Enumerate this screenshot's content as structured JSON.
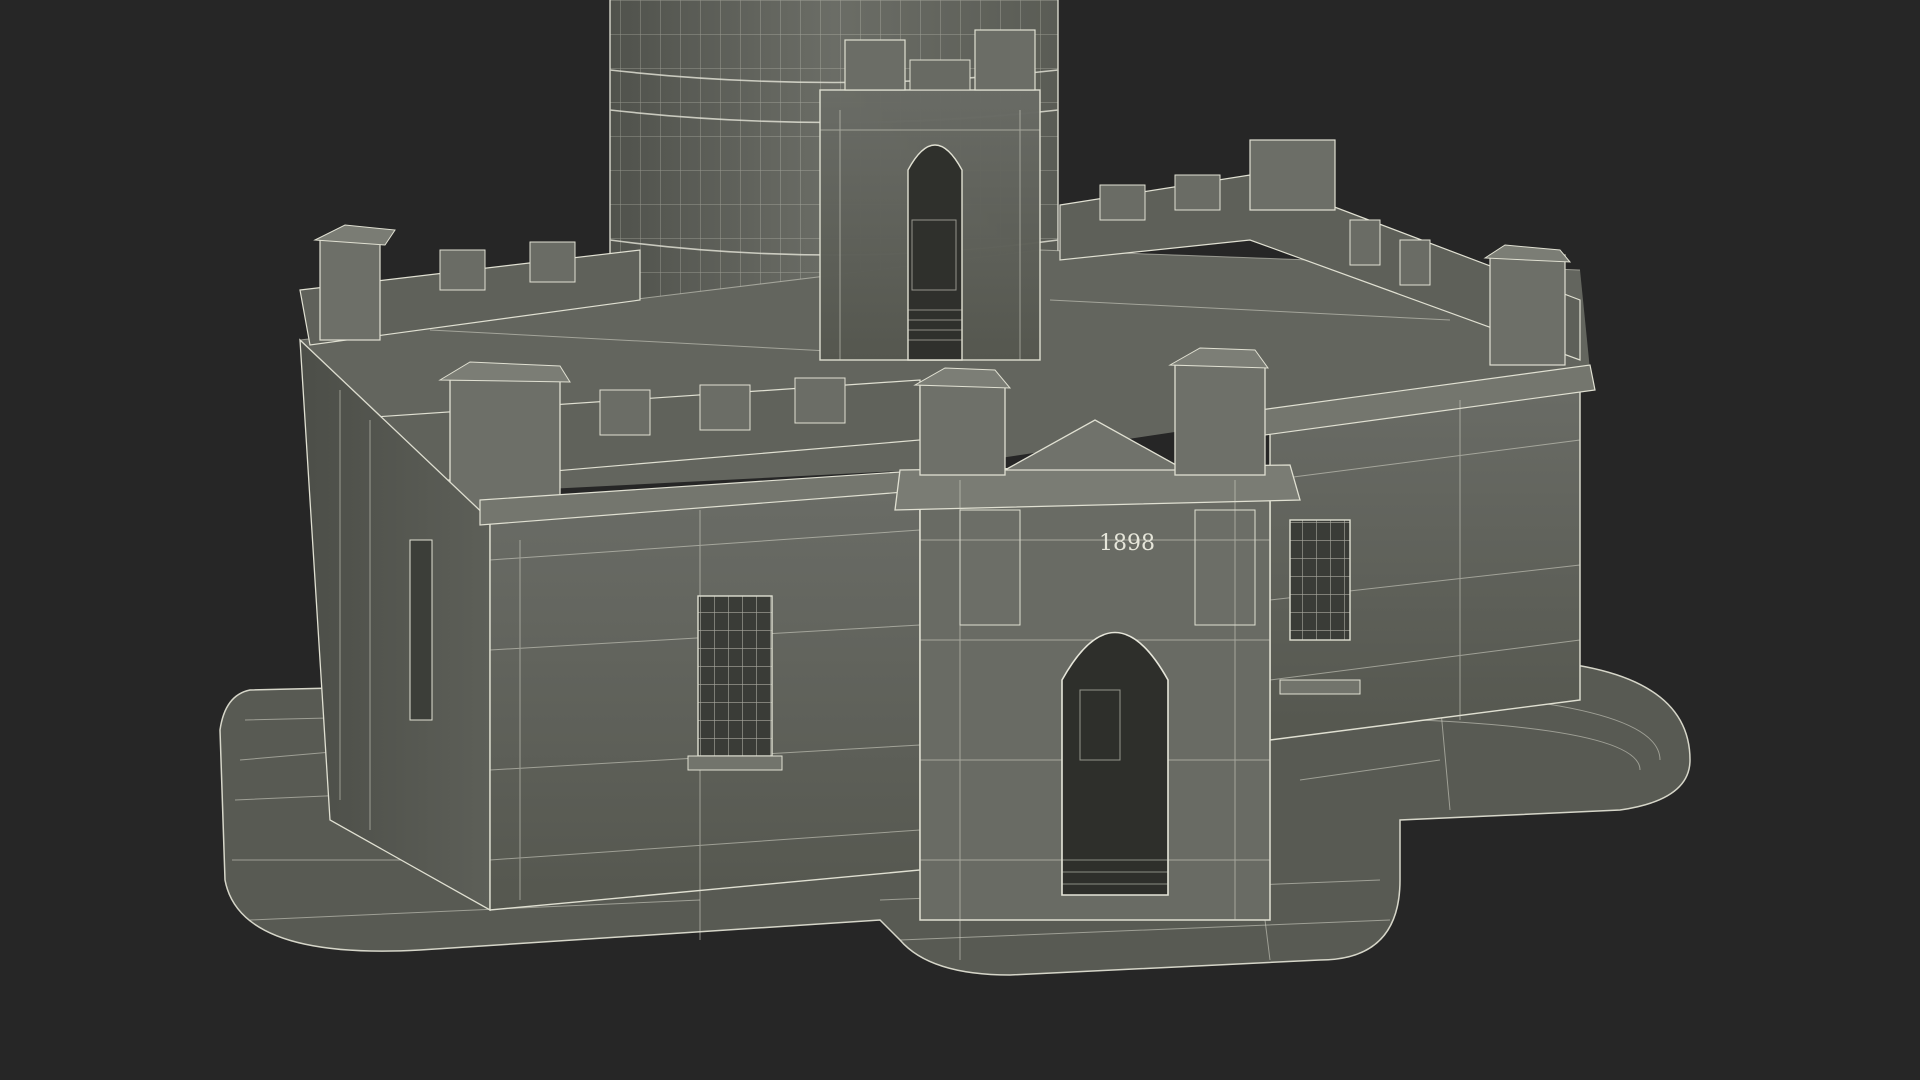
{
  "scene": {
    "background_color": "#262626",
    "model_color": "#5f615b",
    "wire_color": "#e0e0d2",
    "inscription": "1898"
  }
}
